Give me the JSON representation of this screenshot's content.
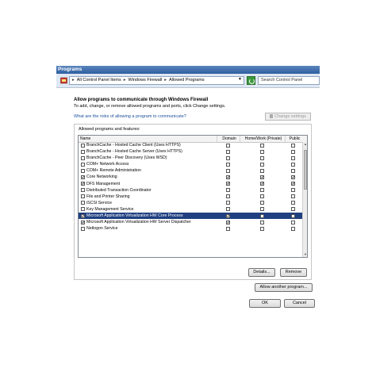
{
  "window": {
    "title": "Programs"
  },
  "address": {
    "segments": [
      "All Control Panel Items",
      "Windows Firewall",
      "Allowed Programs"
    ],
    "separator": "▸",
    "search_placeholder": "Search Control Panel"
  },
  "main": {
    "heading": "Allow programs to communicate through Windows Firewall",
    "description": "To add, change, or remove allowed programs and ports, click Change settings.",
    "risk_link": "What are the risks of allowing a program to communicate?",
    "change_settings": "Change settings",
    "group_label": "Allowed programs and features:",
    "columns": [
      "Name",
      "Domain",
      "Home/Work (Private)",
      "Public"
    ],
    "programs": [
      {
        "name": "BranchCache - Hosted Cache Client (Uses HTTPS)",
        "enabled": false,
        "domain": false,
        "private": false,
        "public": false
      },
      {
        "name": "BranchCache - Hosted Cache Server (Uses HTTPS)",
        "enabled": false,
        "domain": false,
        "private": false,
        "public": false
      },
      {
        "name": "BranchCache - Peer Discovery (Uses WSD)",
        "enabled": false,
        "domain": false,
        "private": false,
        "public": false
      },
      {
        "name": "COM+ Network Access",
        "enabled": false,
        "domain": false,
        "private": false,
        "public": false
      },
      {
        "name": "COM+ Remote Administration",
        "enabled": false,
        "domain": false,
        "private": false,
        "public": false
      },
      {
        "name": "Core Networking",
        "enabled": true,
        "domain": true,
        "private": true,
        "public": true
      },
      {
        "name": "DFS Management",
        "enabled": true,
        "domain": true,
        "private": true,
        "public": true
      },
      {
        "name": "Distributed Transaction Coordinator",
        "enabled": false,
        "domain": false,
        "private": false,
        "public": false
      },
      {
        "name": "File and Printer Sharing",
        "enabled": false,
        "domain": false,
        "private": false,
        "public": false
      },
      {
        "name": "iSCSI Service",
        "enabled": false,
        "domain": false,
        "private": false,
        "public": false
      },
      {
        "name": "Key Management Service",
        "enabled": false,
        "domain": false,
        "private": false,
        "public": false
      },
      {
        "name": "Microsoft Application Virtualization HW Core Process",
        "enabled": true,
        "domain": true,
        "private": false,
        "public": false,
        "selected": true
      },
      {
        "name": "Microsoft Application Virtualization HW Server Dispatcher",
        "enabled": true,
        "domain": true,
        "private": false,
        "public": false
      },
      {
        "name": "Netlogon Service",
        "enabled": false,
        "domain": false,
        "private": false,
        "public": false
      }
    ],
    "details_button": "Details...",
    "remove_button": "Remove",
    "allow_another_button": "Allow another program...",
    "ok_button": "OK",
    "cancel_button": "Cancel"
  }
}
